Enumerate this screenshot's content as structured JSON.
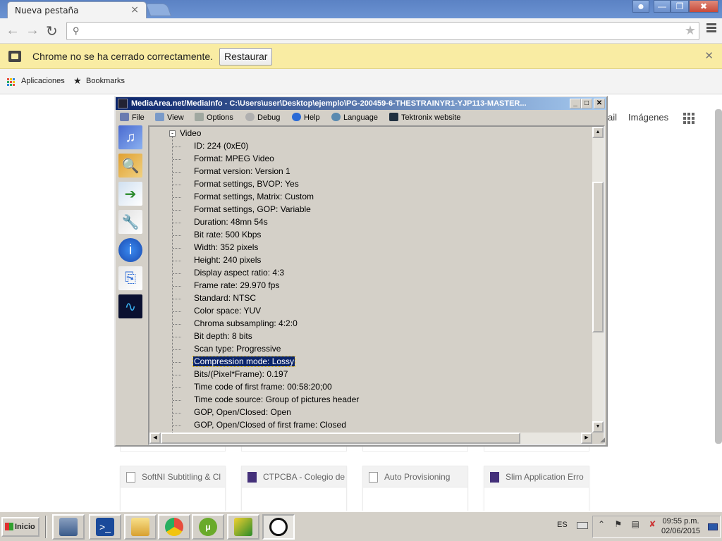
{
  "browser": {
    "tab_title": "Nueva pestaña",
    "window_buttons": [
      "user",
      "minimize",
      "restore",
      "close"
    ],
    "address_value": "",
    "infobar": {
      "message": "Chrome no se ha cerrado correctamente.",
      "button": "Restaurar"
    },
    "bookmarks": [
      "Aplicaciones",
      "Bookmarks"
    ],
    "page": {
      "gbar_links": [
        "ail",
        "Imágenes"
      ],
      "tiles": [
        {
          "label": "SoftNI Subtitling & Cl",
          "icon": "doc"
        },
        {
          "label": "CTPCBA - Colegio de",
          "icon": "ct"
        },
        {
          "label": "Auto Provisioning",
          "icon": "doc"
        },
        {
          "label": "Slim Application Erro",
          "icon": "ct"
        }
      ]
    }
  },
  "mediainfo": {
    "title": "MediaArea.net/MediaInfo - C:\\Users\\user\\Desktop\\ejemplo\\PG-200459-6-THESTRAINYR1-YJP113-MASTER...",
    "menus": [
      "File",
      "View",
      "Options",
      "Debug",
      "Help",
      "Language",
      "Tektronix website"
    ],
    "tree_root": "Video",
    "tree_items": [
      "ID: 224 (0xE0)",
      "Format: MPEG Video",
      "Format version: Version 1",
      "Format settings, BVOP: Yes",
      "Format settings, Matrix: Custom",
      "Format settings, GOP: Variable",
      "Duration: 48mn 54s",
      "Bit rate: 500 Kbps",
      "Width: 352 pixels",
      "Height: 240 pixels",
      "Display aspect ratio: 4:3",
      "Frame rate: 29.970 fps",
      "Standard: NTSC",
      "Color space: YUV",
      "Chroma subsampling: 4:2:0",
      "Bit depth: 8 bits",
      "Scan type: Progressive",
      "Compression mode: Lossy",
      "Bits/(Pixel*Frame): 0.197",
      "Time code of first frame: 00:58:20;00",
      "Time code source: Group of pictures header",
      "GOP, Open/Closed: Open",
      "GOP, Open/Closed of first frame: Closed"
    ],
    "selected_item": "Compression mode: Lossy"
  },
  "taskbar": {
    "start_label": "Inicio",
    "language": "ES",
    "time": "09:55 p.m.",
    "date": "02/06/2015"
  },
  "colors": {
    "title_gradient_start": "#0a246a",
    "title_gradient_end": "#a6caf0",
    "infobar_bg": "#f9eca3",
    "selection": "#0a246a"
  }
}
